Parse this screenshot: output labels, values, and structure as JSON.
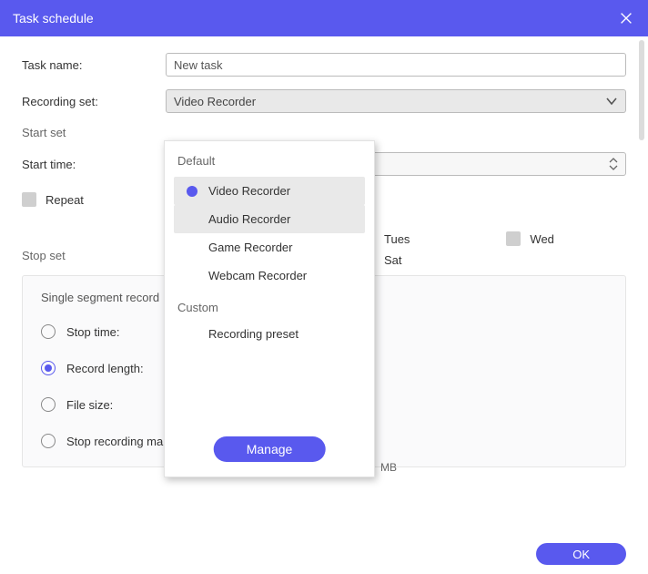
{
  "titlebar": {
    "title": "Task schedule"
  },
  "labels": {
    "task_name": "Task name:",
    "recording_set": "Recording set:",
    "start_set": "Start set",
    "start_time": "Start time:",
    "repeat": "Repeat",
    "stop_set": "Stop set",
    "segment_title": "Single segment record",
    "stop_time": "Stop time:",
    "record_length": "Record length:",
    "file_size": "File size:",
    "stop_manually": "Stop recording manually",
    "mb": "MB"
  },
  "values": {
    "task_name": "New task",
    "recording_set_selected": "Video Recorder"
  },
  "days": {
    "tues": "Tues",
    "wed": "Wed",
    "sat": "Sat"
  },
  "dropdown": {
    "group_default": "Default",
    "items": {
      "video": "Video Recorder",
      "audio": "Audio Recorder",
      "game": "Game Recorder",
      "webcam": "Webcam Recorder"
    },
    "group_custom": "Custom",
    "custom_item": "Recording preset",
    "manage": "Manage"
  },
  "buttons": {
    "ok": "OK"
  }
}
